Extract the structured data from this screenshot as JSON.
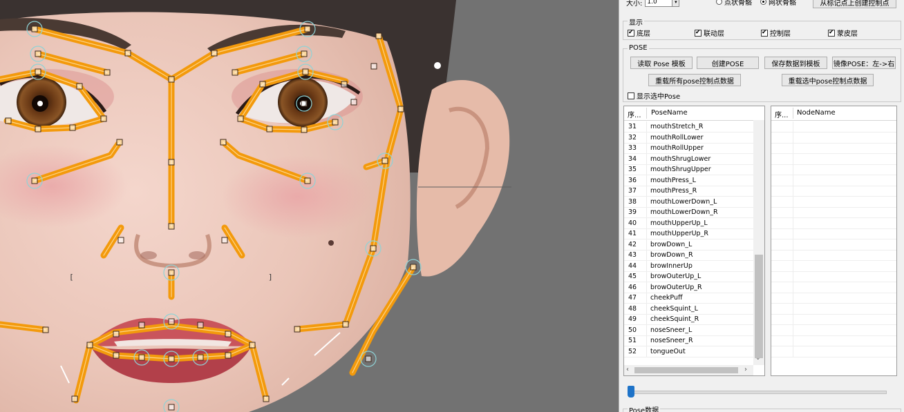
{
  "panel": {
    "size_label": "大小:",
    "size_value": "1.0",
    "radio_a": "点状骨骼",
    "radio_b": "网状骨骼",
    "create_ctrl_btn": "从标记点上创建控制点",
    "display": {
      "title": "显示",
      "items": [
        {
          "label": "底层",
          "checked": true
        },
        {
          "label": "联动层",
          "checked": true
        },
        {
          "label": "控制层",
          "checked": true
        },
        {
          "label": "蒙皮层",
          "checked": true
        }
      ]
    },
    "pose": {
      "title": "POSE",
      "btn_read_template": "读取 Pose 模板",
      "btn_create_pose": "创建POSE",
      "btn_save_template": "保存数据到模板",
      "btn_mirror": "镜像POSE：左->右",
      "btn_reload_all": "重载所有pose控制点数据",
      "btn_reload_selected": "重载选中pose控制点数据",
      "show_selected_label": "显示选中Pose",
      "show_selected_checked": false
    },
    "pose_list": {
      "col_index": "序...",
      "col_name": "PoseName",
      "rows": [
        {
          "idx": "31",
          "name": "mouthStretch_R"
        },
        {
          "idx": "32",
          "name": "mouthRollLower"
        },
        {
          "idx": "33",
          "name": "mouthRollUpper"
        },
        {
          "idx": "34",
          "name": "mouthShrugLower"
        },
        {
          "idx": "35",
          "name": "mouthShrugUpper"
        },
        {
          "idx": "36",
          "name": "mouthPress_L"
        },
        {
          "idx": "37",
          "name": "mouthPress_R"
        },
        {
          "idx": "38",
          "name": "mouthLowerDown_L"
        },
        {
          "idx": "39",
          "name": "mouthLowerDown_R"
        },
        {
          "idx": "40",
          "name": "mouthUpperUp_L"
        },
        {
          "idx": "41",
          "name": "mouthUpperUp_R"
        },
        {
          "idx": "42",
          "name": "browDown_L"
        },
        {
          "idx": "43",
          "name": "browDown_R"
        },
        {
          "idx": "44",
          "name": "browInnerUp"
        },
        {
          "idx": "45",
          "name": "browOuterUp_L"
        },
        {
          "idx": "46",
          "name": "browOuterUp_R"
        },
        {
          "idx": "47",
          "name": "cheekPuff"
        },
        {
          "idx": "48",
          "name": "cheekSquint_L"
        },
        {
          "idx": "49",
          "name": "cheekSquint_R"
        },
        {
          "idx": "50",
          "name": "noseSneer_L"
        },
        {
          "idx": "51",
          "name": "noseSneer_R"
        },
        {
          "idx": "52",
          "name": "tongueOut"
        }
      ]
    },
    "node_list": {
      "col_index": "序...",
      "col_name": "NodeName"
    },
    "pose_data_title": "Pose数据",
    "slider_value": 0.0
  },
  "colors": {
    "bone": "#f39a0c",
    "bone_inner": "#ffe2a6",
    "ring": "#8fd3d6",
    "panel_bg": "#f0f0f0",
    "viewport_bg": "#727272",
    "slider_thumb": "#1e73c8"
  }
}
